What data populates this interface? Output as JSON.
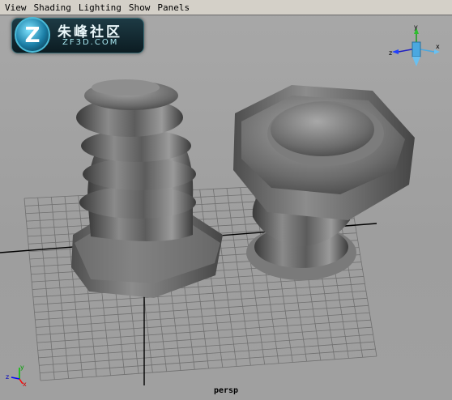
{
  "menu": {
    "items": [
      "View",
      "Shading",
      "Lighting",
      "Show",
      "Panels"
    ]
  },
  "logo": {
    "badge_letter": "Z",
    "chinese_text": "朱峰社区",
    "english_text": "ZF3D.COM"
  },
  "viewport": {
    "camera_label": "persp"
  },
  "view_cube": {
    "y_label": "y",
    "z_label": "z",
    "x_label": "x"
  },
  "corner_axis": {
    "y_label": "y",
    "z_label": "z",
    "x_label": "x"
  },
  "colors": {
    "menubar": "#d4d0c8",
    "viewport_background": "#a3a3a3",
    "grid_lines": "#6f6f6f",
    "grid_axis": "#000000",
    "model_surface": "#6b6b6b",
    "axis_x": "#ff0000",
    "axis_y": "#00c000",
    "axis_z": "#0000ff",
    "view_cube": "#4aa8e0"
  },
  "icons": [
    "view-cube-icon",
    "corner-axis-icon"
  ]
}
